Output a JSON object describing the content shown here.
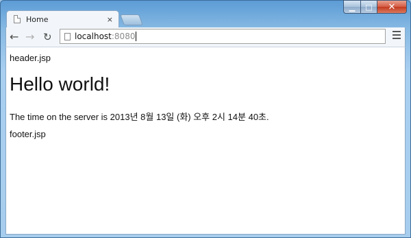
{
  "window": {
    "minimize_glyph": "▁",
    "maximize_glyph": "□",
    "close_glyph": "✕"
  },
  "tab": {
    "title": "Home",
    "close_glyph": "×"
  },
  "toolbar": {
    "back_glyph": "←",
    "forward_glyph": "→",
    "reload_glyph": "↻",
    "url_host": "localhost",
    "url_port": ":8080"
  },
  "page": {
    "header_text": "header.jsp",
    "heading": "Hello world!",
    "server_time": "The time on the server is 2013년 8월 13일 (화) 오후 2시 14분 40초.",
    "footer_text": "footer.jsp"
  },
  "colors": {
    "frame": "#86b9e3",
    "close_button": "#c23a20",
    "toolbar": "#f2f6fa"
  }
}
